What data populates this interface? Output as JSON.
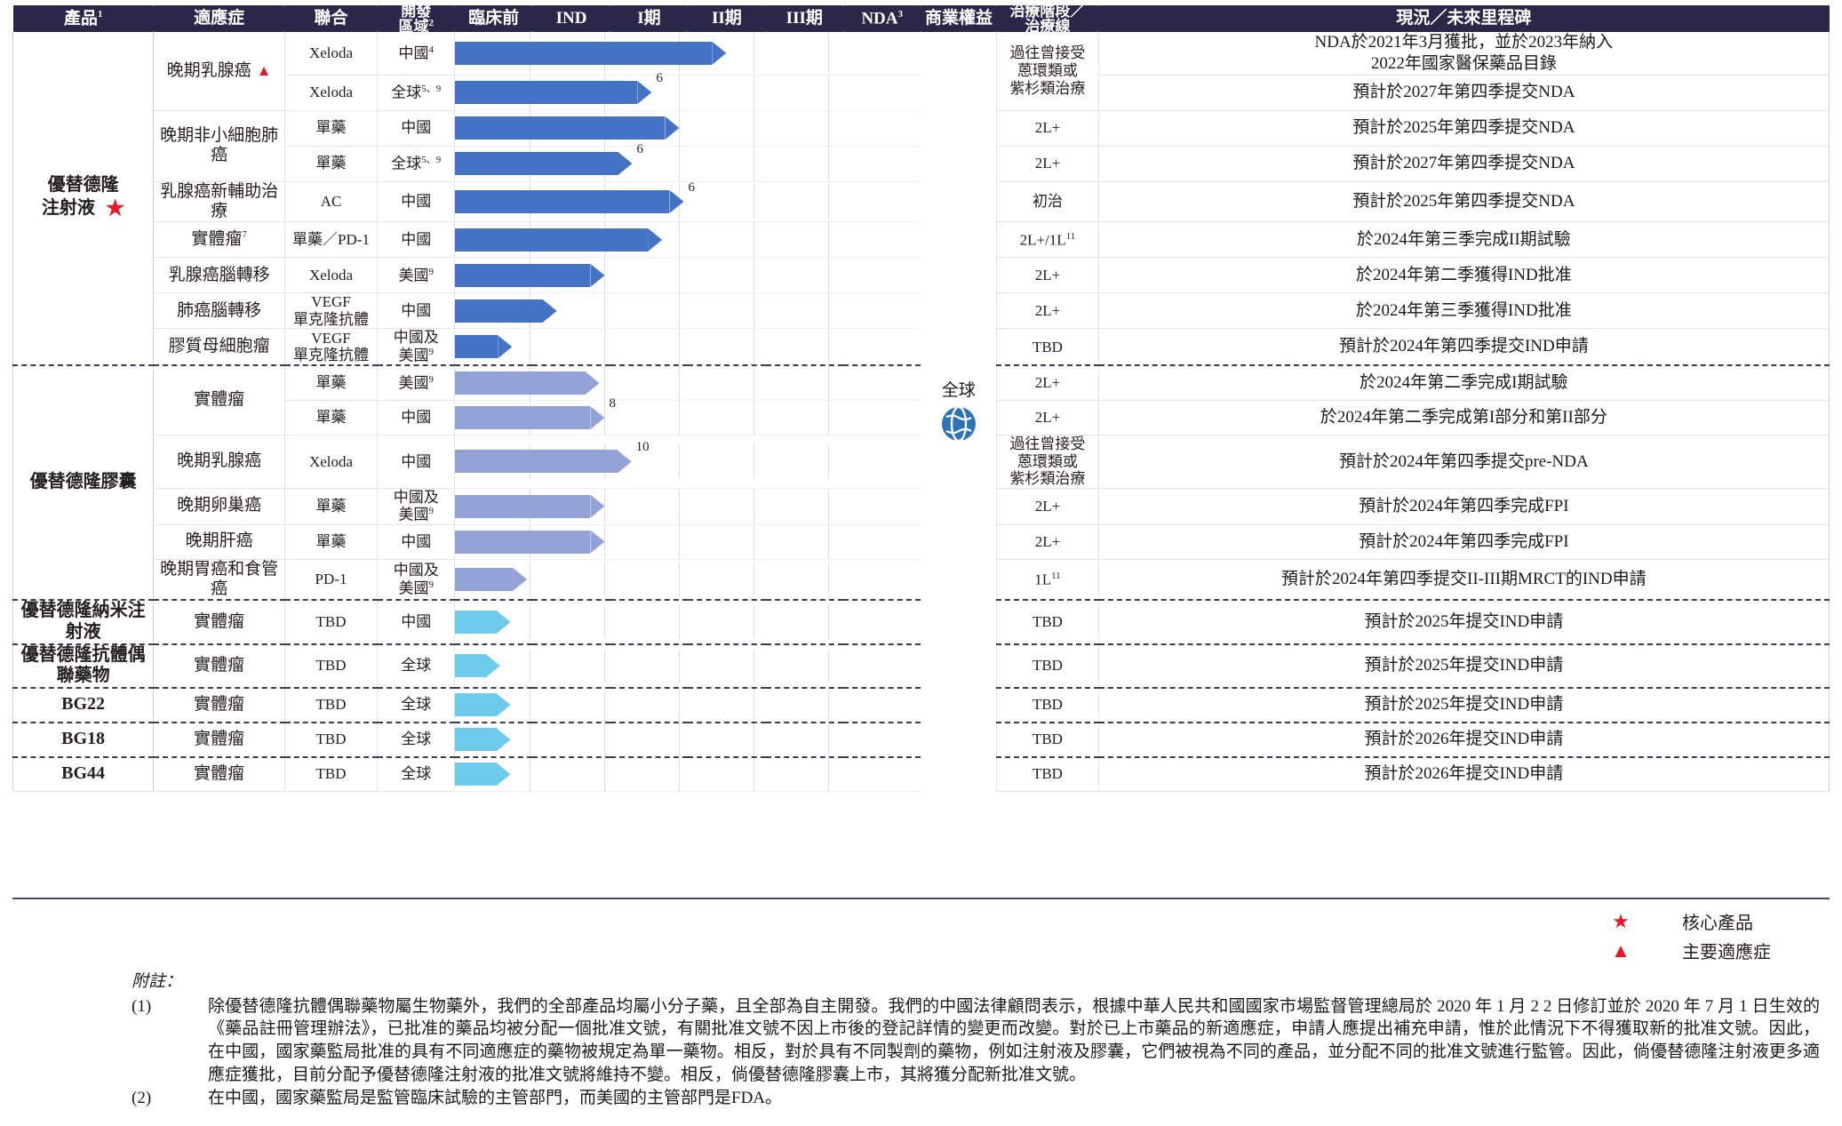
{
  "columns": [
    {
      "id": "product",
      "label": "產品",
      "sup": "1"
    },
    {
      "id": "indication",
      "label": "適應症",
      "sup": ""
    },
    {
      "id": "combination",
      "label": "聯合",
      "sup": ""
    },
    {
      "id": "region",
      "label": "開發\n區域",
      "sup": "2"
    },
    {
      "id": "preclinical",
      "label": "臨床前",
      "sup": ""
    },
    {
      "id": "ind",
      "label": "IND",
      "sup": ""
    },
    {
      "id": "phase1",
      "label": "I期",
      "sup": ""
    },
    {
      "id": "phase2",
      "label": "II期",
      "sup": ""
    },
    {
      "id": "phase3",
      "label": "III期",
      "sup": ""
    },
    {
      "id": "nda",
      "label": "NDA",
      "sup": "3"
    },
    {
      "id": "commercial",
      "label": "商業權益",
      "sup": ""
    },
    {
      "id": "line",
      "label": "治療階段／\n治療線",
      "sup": ""
    },
    {
      "id": "milestone",
      "label": "現況／未來里程碑",
      "sup": ""
    }
  ],
  "products": [
    {
      "name": "優替德隆\n注射液",
      "core_product": true,
      "bar_color": "#4472c4",
      "rows": [
        {
          "indication": "晚期乳腺癌",
          "indication_key": true,
          "indication_rowspan": 2,
          "combination": "Xeloda",
          "region": "中國",
          "region_sup": "4",
          "bar_end": 3.63,
          "bar_sup": "",
          "line": "過往曾接受\n蒽環類或\n紫杉類治療",
          "line_rowspan": 2,
          "milestone": "NDA於2021年3月獲批，並於2023年納入\n2022年國家醫保藥品目錄"
        },
        {
          "indication": "",
          "combination": "Xeloda",
          "region": "全球",
          "region_sup": "5、9",
          "bar_end": 2.63,
          "bar_sup": "6",
          "milestone": "預計於2027年第四季提交NDA"
        },
        {
          "indication": "晚期非小細胞肺癌",
          "indication_rowspan": 2,
          "combination": "單藥",
          "region": "中國",
          "region_sup": "",
          "bar_end": 3.0,
          "bar_sup": "",
          "line": "2L+",
          "milestone": "預計於2025年第四季提交NDA"
        },
        {
          "indication": "",
          "combination": "單藥",
          "region": "全球",
          "region_sup": "5、9",
          "bar_end": 2.37,
          "bar_sup": "6",
          "line": "2L+",
          "milestone": "預計於2027年第四季提交NDA"
        },
        {
          "indication": "乳腺癌新輔助治療",
          "combination": "AC",
          "region": "中國",
          "region_sup": "",
          "bar_end": 3.06,
          "bar_sup": "6",
          "line": "初治",
          "milestone": "預計於2025年第四季提交NDA"
        },
        {
          "indication": "實體瘤",
          "indication_sup": "7",
          "combination": "單藥／PD-1",
          "region": "中國",
          "region_sup": "",
          "bar_end": 2.77,
          "bar_sup": "",
          "line": "2L+/1L",
          "line_sup": "11",
          "milestone": "於2024年第三季完成II期試驗"
        },
        {
          "indication": "乳腺癌腦轉移",
          "combination": "Xeloda",
          "region": "美國",
          "region_sup": "9",
          "bar_end": 2.0,
          "bar_sup": "",
          "line": "2L+",
          "milestone": "於2024年第二季獲得IND批准"
        },
        {
          "indication": "肺癌腦轉移",
          "combination": "VEGF\n單克隆抗體",
          "region": "中國",
          "region_sup": "",
          "bar_end": 1.36,
          "bar_sup": "",
          "line": "2L+",
          "milestone": "於2024年第三季獲得IND批准"
        },
        {
          "indication": "膠質母細胞瘤",
          "combination": "VEGF\n單克隆抗體",
          "region": "中國及\n美國",
          "region_sup": "9",
          "bar_end": 0.76,
          "bar_sup": "",
          "line": "TBD",
          "milestone": "預計於2024年第四季提交IND申請"
        }
      ]
    },
    {
      "name": "優替德隆膠囊",
      "core_product": false,
      "bar_color": "#93a2d7",
      "rows": [
        {
          "indication": "實體瘤",
          "indication_rowspan": 2,
          "combination": "單藥",
          "region": "美國",
          "region_sup": "9",
          "bar_end": 1.93,
          "bar_sup": "",
          "line": "2L+",
          "milestone": "於2024年第二季完成I期試驗"
        },
        {
          "indication": "",
          "combination": "單藥",
          "region": "中國",
          "region_sup": "",
          "bar_end": 2.0,
          "bar_sup": "8",
          "line": "2L+",
          "milestone": "於2024年第二季完成第I部分和第II部分"
        },
        {
          "indication": "晚期乳腺癌",
          "combination": "Xeloda",
          "region": "中國",
          "region_sup": "",
          "bar_end": 2.36,
          "bar_sup": "10",
          "line": "過往曾接受\n蒽環類或\n紫杉類治療",
          "milestone": "預計於2024年第四季提交pre-NDA"
        },
        {
          "indication": "晚期卵巢癌",
          "combination": "單藥",
          "region": "中國及\n美國",
          "region_sup": "9",
          "bar_end": 2.0,
          "bar_sup": "",
          "line": "2L+",
          "milestone": "預計於2024年第四季完成FPI"
        },
        {
          "indication": "晚期肝癌",
          "combination": "單藥",
          "region": "中國",
          "region_sup": "",
          "bar_end": 2.0,
          "bar_sup": "",
          "line": "2L+",
          "milestone": "預計於2024年第四季完成FPI"
        },
        {
          "indication": "晚期胃癌和食管癌",
          "combination": "PD-1",
          "region": "中國及\n美國",
          "region_sup": "9",
          "bar_end": 0.96,
          "bar_sup": "",
          "line": "1L",
          "line_sup": "11",
          "milestone": "預計於2024年第四季提交II-III期MRCT的IND申請"
        }
      ]
    },
    {
      "name": "優替德隆納米注射液",
      "core_product": false,
      "bar_color": "#6ecbeb",
      "rows": [
        {
          "indication": "實體瘤",
          "combination": "TBD",
          "region": "中國",
          "region_sup": "",
          "bar_end": 0.74,
          "bar_sup": "",
          "line": "TBD",
          "milestone": "預計於2025年提交IND申請"
        }
      ]
    },
    {
      "name": "優替德隆抗體偶聯藥物",
      "core_product": false,
      "bar_color": "#6ecbeb",
      "rows": [
        {
          "indication": "實體瘤",
          "combination": "TBD",
          "region": "全球",
          "region_sup": "",
          "bar_end": 0.6,
          "bar_sup": "",
          "line": "TBD",
          "milestone": "預計於2025年提交IND申請"
        }
      ]
    },
    {
      "name": "BG22",
      "core_product": false,
      "bar_color": "#6ecbeb",
      "rows": [
        {
          "indication": "實體瘤",
          "combination": "TBD",
          "region": "全球",
          "region_sup": "",
          "bar_end": 0.74,
          "bar_sup": "",
          "line": "TBD",
          "milestone": "預計於2025年提交IND申請"
        }
      ]
    },
    {
      "name": "BG18",
      "core_product": false,
      "bar_color": "#6ecbeb",
      "rows": [
        {
          "indication": "實體瘤",
          "combination": "TBD",
          "region": "全球",
          "region_sup": "",
          "bar_end": 0.74,
          "bar_sup": "",
          "line": "TBD",
          "milestone": "預計於2026年提交IND申請"
        }
      ]
    },
    {
      "name": "BG44",
      "core_product": false,
      "bar_color": "#6ecbeb",
      "rows": [
        {
          "indication": "實體瘤",
          "combination": "TBD",
          "region": "全球",
          "region_sup": "",
          "bar_end": 0.74,
          "bar_sup": "",
          "line": "TBD",
          "milestone": "預計於2026年提交IND申請"
        }
      ]
    }
  ],
  "commercial_rights": {
    "label": "全球",
    "icon": "globe-icon"
  },
  "legend": [
    {
      "glyph": "star",
      "symbol": "★",
      "label": "核心產品"
    },
    {
      "glyph": "triangle",
      "symbol": "▲",
      "label": "主要適應症"
    }
  ],
  "notes": {
    "title": "附註：",
    "items": [
      {
        "num": "(1)",
        "text": "除優替德隆抗體偶聯藥物屬生物藥外，我們的全部產品均屬小分子藥，且全部為自主開發。我們的中國法律顧問表示，根據中華人民共和國國家市場監督管理總局於 2020 年 1 月 2 2 日修訂並於 2020 年 7 月 1 日生效的《藥品註冊管理辦法》，已批准的藥品均被分配一個批准文號，有關批准文號不因上市後的登記詳情的變更而改變。對於已上市藥品的新適應症，申請人應提出補充申請，惟於此情況下不得獲取新的批准文號。因此，在中國，國家藥監局批准的具有不同適應症的藥物被規定為單一藥物。相反，對於具有不同製劑的藥物，例如注射液及膠囊，它們被視為不同的產品，並分配不同的批准文號進行監管。因此，倘優替德隆注射液更多適應症獲批，目前分配予優替德隆注射液的批准文號將維持不變。相反，倘優替德隆膠囊上市，其將獲分配新批准文號。"
      },
      {
        "num": "(2)",
        "text": "在中國，國家藥監局是監管臨床試驗的主管部門，而美國的主管部門是FDA。"
      }
    ]
  },
  "colors": {
    "header_bg": "#2b2749",
    "bar_dark": "#4472c4",
    "bar_mid": "#93a2d7",
    "bar_light": "#6ecbeb",
    "accent_red": "#e8172a",
    "globe_blue": "#2e74b5"
  }
}
